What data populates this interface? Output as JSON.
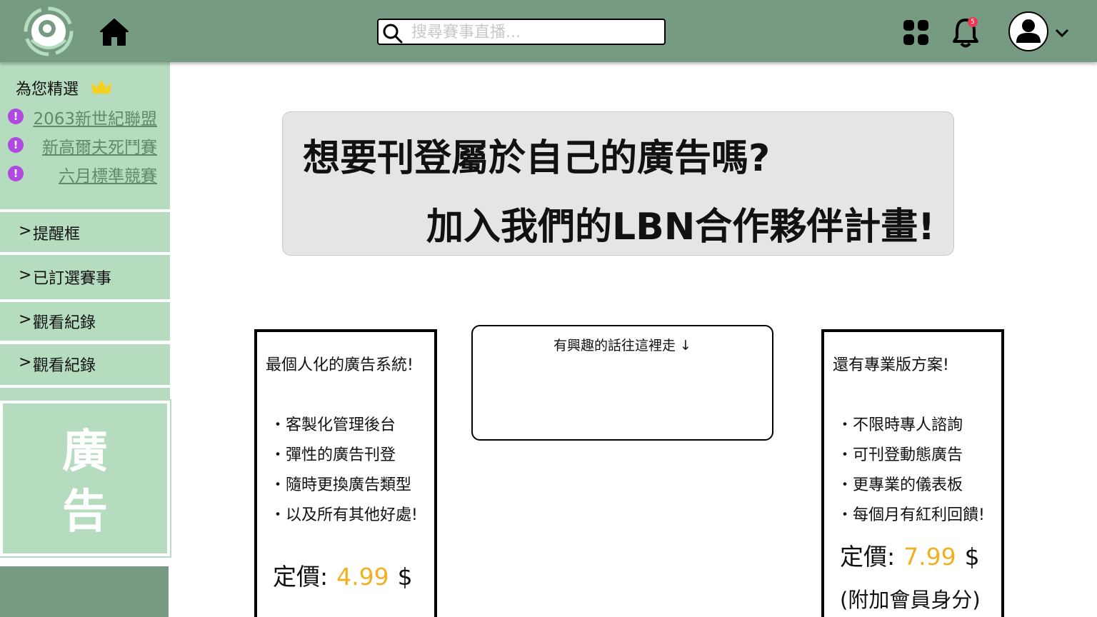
{
  "header": {
    "search_placeholder": "搜尋賽事直播...",
    "notification_count": "5",
    "icons": [
      "app-logo-icon",
      "home-icon",
      "search-icon",
      "apps-grid-icon",
      "bell-icon",
      "user-avatar-icon",
      "chevron-down-icon"
    ]
  },
  "sidebar": {
    "picks_title": "為您精選",
    "picks": [
      {
        "label": "2063新世紀聯盟"
      },
      {
        "label": "新高爾夫死鬥賽"
      },
      {
        "label": "六月標準競賽"
      }
    ],
    "pick_marker": "!",
    "menu": [
      {
        "label": "提醒框"
      },
      {
        "label": "已訂選賽事"
      },
      {
        "label": "觀看紀錄"
      },
      {
        "label": "觀看紀錄"
      }
    ],
    "menu_arrow": ">",
    "ad": {
      "line1": "廣",
      "line2": "告"
    }
  },
  "banner": {
    "line1": "想要刊登屬於自己的廣告嗎?",
    "line2": "加入我們的LBN合作夥伴計畫!"
  },
  "card_basic": {
    "title": "最個人化的廣告系統!",
    "features": [
      "・客製化管理後台",
      "・彈性的廣告刊登",
      "・隨時更換廣告類型",
      "・以及所有其他好處!"
    ],
    "price_label": "定價:",
    "price_value": "4.99",
    "currency": "$"
  },
  "interest_box": {
    "label": "有興趣的話往這裡走 ↓"
  },
  "card_pro": {
    "title": "還有專業版方案!",
    "features": [
      "・不限時專人諮詢",
      "・可刊登動態廣告",
      "・更專業的儀表板",
      "・每個月有紅利回饋!"
    ],
    "price_label": "定價:",
    "price_value": "7.99",
    "currency": "$",
    "note": "(附加會員身分)"
  },
  "colors": {
    "header_green": "#779a82",
    "sidebar_green": "#b6dcc0",
    "link_green": "#5f8a6c",
    "price_yellow": "#f0b020",
    "marker_purple": "#b148e0",
    "badge_red": "#e83a57",
    "crown_yellow": "#f5d020"
  }
}
